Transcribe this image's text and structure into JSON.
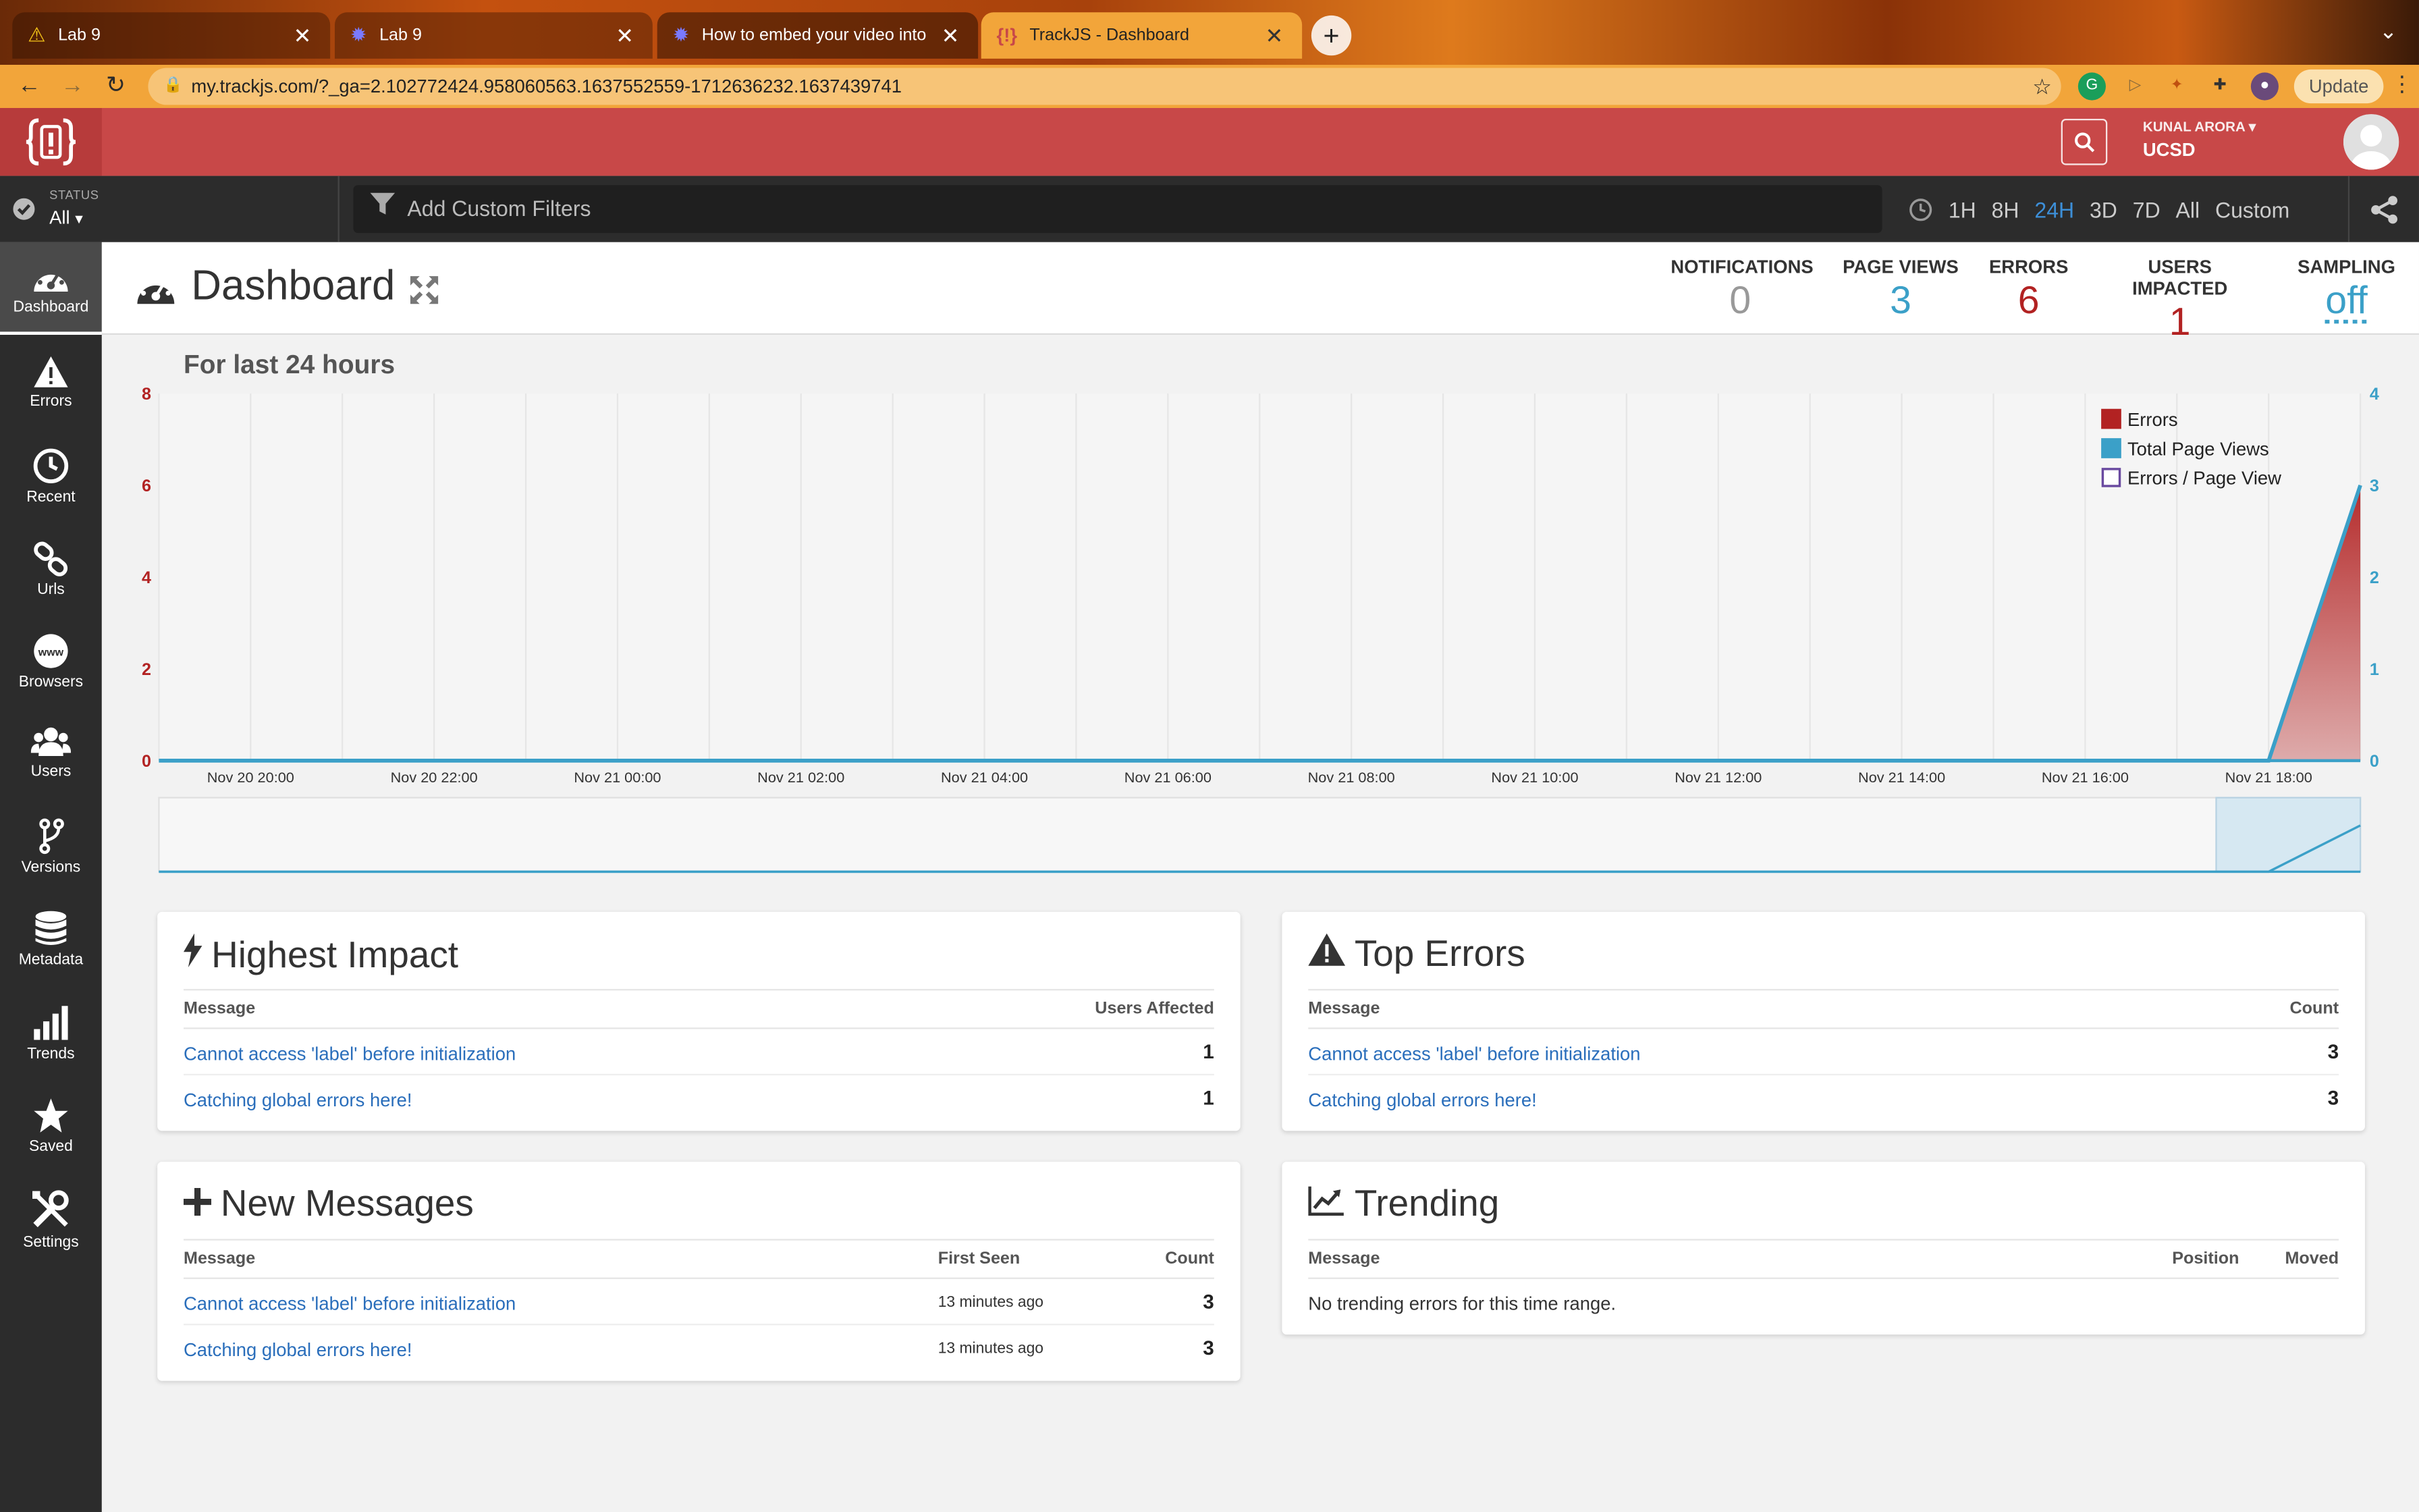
{
  "browser": {
    "tabs": [
      {
        "title": "Lab 9",
        "icon": "warning-icon"
      },
      {
        "title": "Lab 9",
        "icon": "gear-icon"
      },
      {
        "title": "How to embed your video into",
        "icon": "gear-icon"
      },
      {
        "title": "TrackJS - Dashboard",
        "icon": "trackjs-icon"
      }
    ],
    "url": "my.trackjs.com/?_ga=2.102772424.958060563.1637552559-1712636232.1637439741",
    "update_label": "Update"
  },
  "header": {
    "user_name": "KUNAL ARORA",
    "org": "UCSD"
  },
  "filters": {
    "status_label": "STATUS",
    "status_value": "All",
    "custom_placeholder": "Add Custom Filters",
    "ranges": [
      "1H",
      "8H",
      "24H",
      "3D",
      "7D",
      "All",
      "Custom"
    ],
    "selected_range": "24H"
  },
  "sidebar": {
    "items": [
      {
        "label": "Dashboard",
        "icon": "dashboard-icon"
      },
      {
        "label": "Errors",
        "icon": "warning-icon"
      },
      {
        "label": "Recent",
        "icon": "clock-icon"
      },
      {
        "label": "Urls",
        "icon": "link-icon"
      },
      {
        "label": "Browsers",
        "icon": "www-icon"
      },
      {
        "label": "Users",
        "icon": "users-icon"
      },
      {
        "label": "Versions",
        "icon": "branch-icon"
      },
      {
        "label": "Metadata",
        "icon": "database-icon"
      },
      {
        "label": "Trends",
        "icon": "bar-chart-icon"
      },
      {
        "label": "Saved",
        "icon": "star-icon"
      },
      {
        "label": "Settings",
        "icon": "tools-icon"
      }
    ]
  },
  "page": {
    "title": "Dashboard",
    "stats": [
      {
        "label": "NOTIFICATIONS",
        "value": "0",
        "color": "#999999"
      },
      {
        "label": "PAGE VIEWS",
        "value": "3",
        "color": "#3ba0c8"
      },
      {
        "label": "ERRORS",
        "value": "6",
        "color": "#b22222"
      },
      {
        "label": "USERS IMPACTED",
        "value": "1",
        "color": "#b22222"
      },
      {
        "label": "SAMPLING",
        "value": "off",
        "color": "#3ba0c8"
      }
    ]
  },
  "chart_data": {
    "type": "area",
    "title": "For last 24 hours",
    "x": [
      "Nov 20 19:00",
      "Nov 20 20:00",
      "Nov 20 21:00",
      "Nov 20 22:00",
      "Nov 20 23:00",
      "Nov 21 00:00",
      "Nov 21 01:00",
      "Nov 21 02:00",
      "Nov 21 03:00",
      "Nov 21 04:00",
      "Nov 21 05:00",
      "Nov 21 06:00",
      "Nov 21 07:00",
      "Nov 21 08:00",
      "Nov 21 09:00",
      "Nov 21 10:00",
      "Nov 21 11:00",
      "Nov 21 12:00",
      "Nov 21 13:00",
      "Nov 21 14:00",
      "Nov 21 15:00",
      "Nov 21 16:00",
      "Nov 21 17:00",
      "Nov 21 18:00",
      "Nov 21 19:00"
    ],
    "xticks": [
      "Nov 20 20:00",
      "Nov 20 22:00",
      "Nov 21 00:00",
      "Nov 21 02:00",
      "Nov 21 04:00",
      "Nov 21 06:00",
      "Nov 21 08:00",
      "Nov 21 10:00",
      "Nov 21 12:00",
      "Nov 21 14:00",
      "Nov 21 16:00",
      "Nov 21 18:00"
    ],
    "series": [
      {
        "name": "Errors",
        "axis": "left",
        "color": "#b22222",
        "values": [
          0,
          0,
          0,
          0,
          0,
          0,
          0,
          0,
          0,
          0,
          0,
          0,
          0,
          0,
          0,
          0,
          0,
          0,
          0,
          0,
          0,
          0,
          0,
          0,
          6
        ]
      },
      {
        "name": "Total Page Views",
        "axis": "right",
        "color": "#3ba0c8",
        "values": [
          0,
          0,
          0,
          0,
          0,
          0,
          0,
          0,
          0,
          0,
          0,
          0,
          0,
          0,
          0,
          0,
          0,
          0,
          0,
          0,
          0,
          0,
          0,
          0,
          3
        ]
      },
      {
        "name": "Errors / Page View",
        "axis": "right",
        "color": "#6a4aa0",
        "values": []
      }
    ],
    "ylim_left": [
      0,
      8
    ],
    "yticks_left": [
      0,
      2,
      4,
      6,
      8
    ],
    "ylim_right": [
      0,
      4
    ],
    "yticks_right": [
      0,
      1,
      2,
      3,
      4
    ],
    "grid": true,
    "legend": "top-right"
  },
  "panels": {
    "highest_impact": {
      "title": "Highest Impact",
      "columns": [
        "Message",
        "Users Affected"
      ],
      "rows": [
        {
          "message": "Cannot access 'label' before initialization",
          "count": "1"
        },
        {
          "message": "Catching global errors here!",
          "count": "1"
        }
      ]
    },
    "top_errors": {
      "title": "Top Errors",
      "columns": [
        "Message",
        "Count"
      ],
      "rows": [
        {
          "message": "Cannot access 'label' before initialization",
          "count": "3"
        },
        {
          "message": "Catching global errors here!",
          "count": "3"
        }
      ]
    },
    "new_messages": {
      "title": "New Messages",
      "columns": [
        "Message",
        "First Seen",
        "Count"
      ],
      "rows": [
        {
          "message": "Cannot access 'label' before initialization",
          "seen": "13 minutes ago",
          "count": "3"
        },
        {
          "message": "Catching global errors here!",
          "seen": "13 minutes ago",
          "count": "3"
        }
      ]
    },
    "trending": {
      "title": "Trending",
      "columns": [
        "Message",
        "Position",
        "Moved"
      ],
      "empty": "No trending errors for this time range."
    }
  }
}
